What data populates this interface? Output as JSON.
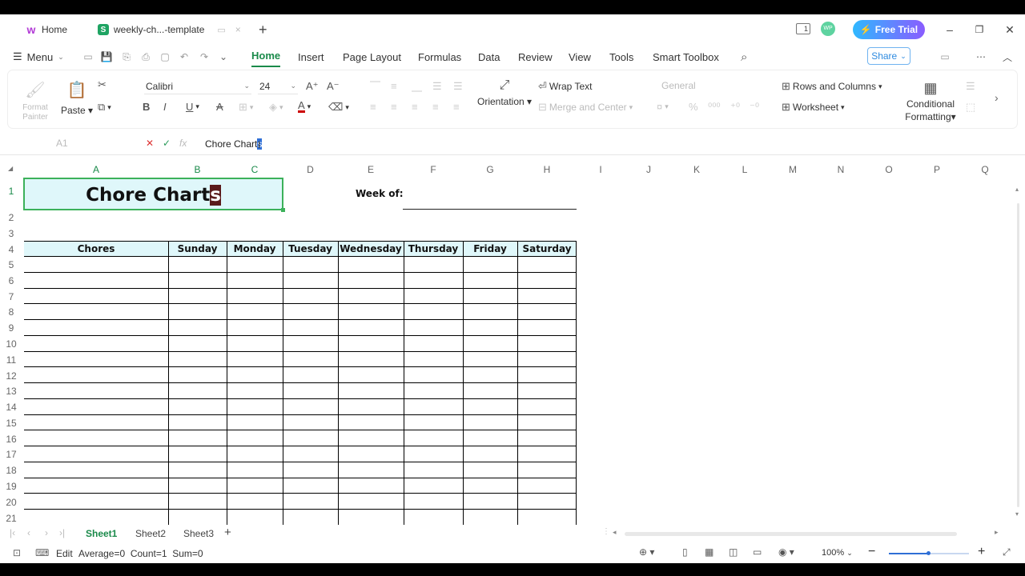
{
  "tabs": {
    "home_label": "Home",
    "doc_label": "weekly-ch...-template",
    "doc_icon_letter": "S",
    "new_tab": "+"
  },
  "titlebar": {
    "badge_num": "1",
    "avatar_text": "WP",
    "free_trial": "Free Trial"
  },
  "menubar": {
    "menu_label": "Menu",
    "items": [
      "Home",
      "Insert",
      "Page Layout",
      "Formulas",
      "Data",
      "Review",
      "View",
      "Tools",
      "Smart Toolbox"
    ],
    "share_label": "Share",
    "more": "⋯"
  },
  "ribbon": {
    "format_painter": "Format Painter",
    "paste": "Paste",
    "font_name": "Calibri",
    "font_size": "24",
    "orientation": "Orientation",
    "wrap_text": "Wrap Text",
    "merge_center": "Merge and Center",
    "number_format": "General",
    "rows_columns": "Rows and Columns",
    "worksheet": "Worksheet",
    "conditional_formatting_1": "Conditional",
    "conditional_formatting_2": "Formatting",
    "font_color": "#cc0000"
  },
  "formula": {
    "cell_ref": "A1",
    "content": "Chore Chart",
    "content_selected": "s"
  },
  "grid": {
    "col_labels": [
      "A",
      "B",
      "C",
      "D",
      "E",
      "F",
      "G",
      "H",
      "I",
      "J",
      "K",
      "L",
      "M",
      "N",
      "O",
      "P",
      "Q"
    ],
    "row_labels": [
      "1",
      "2",
      "3",
      "4",
      "5",
      "6",
      "7",
      "8",
      "9",
      "10",
      "11",
      "12",
      "13",
      "14",
      "15",
      "16",
      "17",
      "18",
      "19",
      "20",
      "21"
    ]
  },
  "sheet": {
    "title": "Chore Chart",
    "title_selected": "s",
    "week_of": "Week of:",
    "headers": [
      "Chores",
      "Sunday",
      "Monday",
      "Tuesday",
      "Wednesday",
      "Thursday",
      "Friday",
      "Saturday"
    ],
    "header_fill": "#dff7fa"
  },
  "sheet_tabs": [
    "Sheet1",
    "Sheet2",
    "Sheet3"
  ],
  "status": {
    "mode": "Edit",
    "stats": "Average=0  Count=1  Sum=0",
    "zoom": "100%"
  },
  "colors": {
    "accent_green": "#1a8a4a",
    "trial_gradient_start": "#2fb8ff",
    "trial_gradient_end": "#8a5cff"
  }
}
